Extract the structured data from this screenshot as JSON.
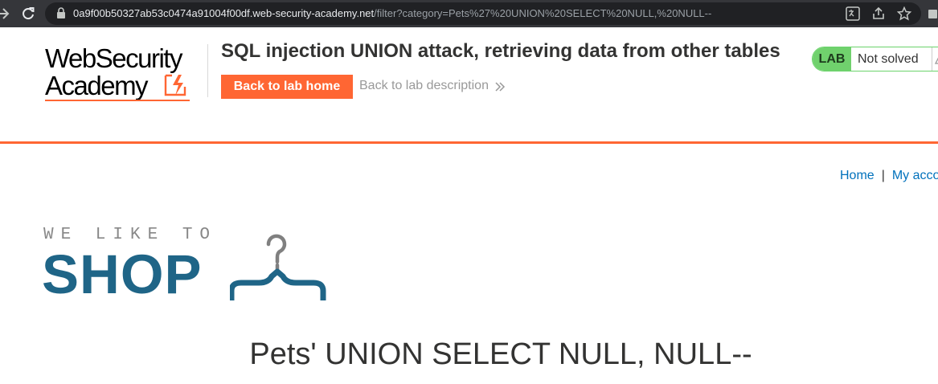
{
  "browser": {
    "url_host": "0a9f00b50327ab53c0474a91004f00df.web-security-academy.net",
    "url_path": "/filter?category=Pets%27%20UNION%20SELECT%20NULL,%20NULL--",
    "icons": [
      "back-arrow-icon",
      "reload-icon",
      "lock-icon",
      "translate-icon",
      "share-icon",
      "star-icon",
      "extensions-icon"
    ]
  },
  "lab_header": {
    "logo_line1": "WebSecurity",
    "logo_line2": "Academy",
    "title": "SQL injection UNION attack, retrieving data from other tables",
    "back_home_label": "Back to lab home",
    "back_description_label": "Back to lab description",
    "status_badge": "LAB",
    "status_text": "Not solved",
    "colors": {
      "accent": "#ff6633",
      "badge_green": "#70d16d"
    }
  },
  "shop": {
    "nav": {
      "home": "Home",
      "separator": "|",
      "account": "My account"
    },
    "logo_tagline": "WE LIKE TO",
    "logo_word": "SHOP",
    "heading": "Pets' UNION SELECT NULL, NULL--",
    "colors": {
      "logo_blue": "#1f6587",
      "link_blue": "#0071bc"
    }
  }
}
